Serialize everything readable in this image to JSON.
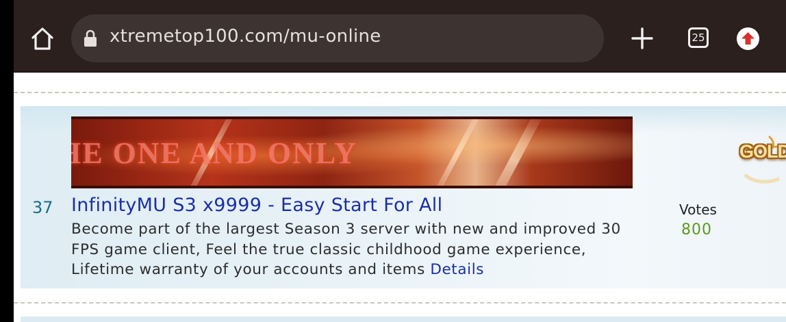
{
  "browser": {
    "url": "xtremetop100.com/mu-online",
    "tab_count": "25"
  },
  "listing": {
    "rank": "37",
    "banner_text": "HE ONE AND ONLY",
    "title": "InfinityMU S3 x9999 - Easy Start For All",
    "description": "Become part of the largest Season 3 server with new and improved 30 FPS game client, Feel the true classic childhood game experience, Lifetime warranty of your accounts and items",
    "details_label": "Details",
    "votes_label": "Votes",
    "votes_value": "800",
    "badge_text": "GOLD"
  },
  "colors": {
    "toolbar": "#2b201d",
    "link": "#1b2ea8",
    "rank": "#1a6d86",
    "votes": "#5c9a1a"
  },
  "icons": [
    "home-icon",
    "lock-icon",
    "plus-icon",
    "tabs-icon",
    "update-icon"
  ]
}
